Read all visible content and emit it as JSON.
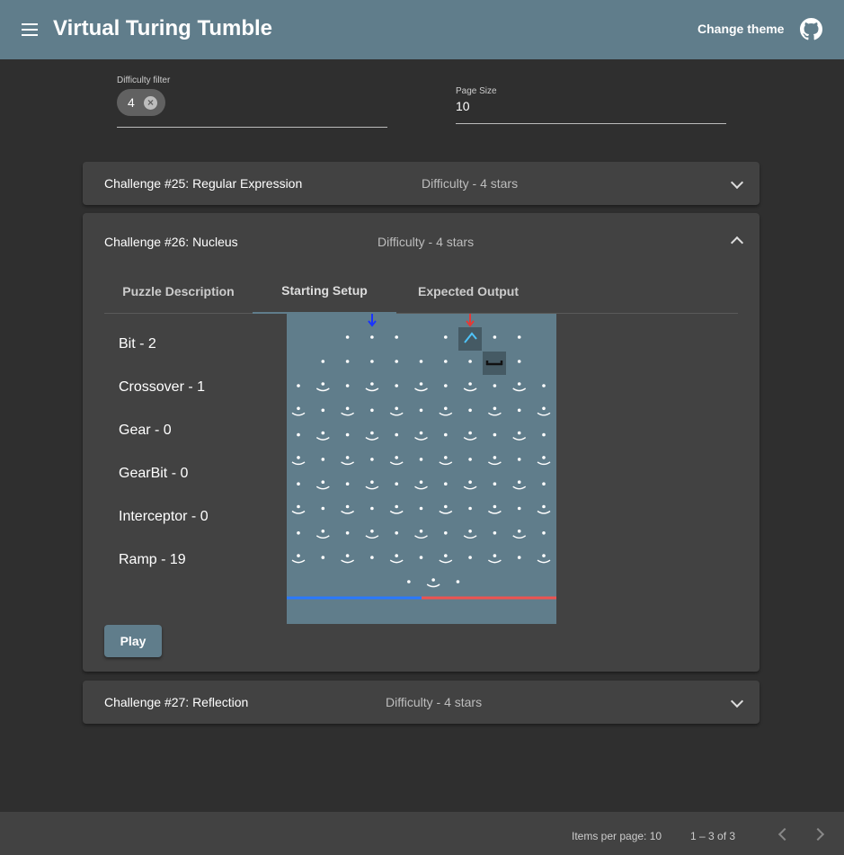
{
  "header": {
    "title": "Virtual Turing Tumble",
    "change_theme": "Change theme",
    "menu_icon": "menu-icon",
    "github_icon": "github-icon",
    "color": "#607d8b"
  },
  "filters": {
    "difficulty_label": "Difficulty filter",
    "difficulty_chip": "4",
    "page_size_label": "Page Size",
    "page_size_value": "10"
  },
  "challenges": [
    {
      "title": "Challenge #25: Regular Expression",
      "difficulty": "Difficulty - 4 stars",
      "expanded": false
    },
    {
      "title": "Challenge #26: Nucleus",
      "difficulty": "Difficulty - 4 stars",
      "expanded": true,
      "tabs": [
        "Puzzle Description",
        "Starting Setup",
        "Expected Output"
      ],
      "active_tab": "Starting Setup",
      "parts": [
        "Bit - 2",
        "Crossover - 1",
        "Gear - 0",
        "GearBit - 0",
        "Interceptor - 0",
        "Ramp - 19"
      ],
      "play_label": "Play"
    },
    {
      "title": "Challenge #27: Reflection",
      "difficulty": "Difficulty - 4 stars",
      "expanded": false
    }
  ],
  "paginator": {
    "items_per_page": "Items per page: 10",
    "range": "1 – 3 of 3"
  },
  "colors": {
    "board": "#607d8b",
    "blue_rail": "#2979ff",
    "red_rail": "#ef5350",
    "panel": "#424242",
    "background": "#2f2f2f"
  }
}
